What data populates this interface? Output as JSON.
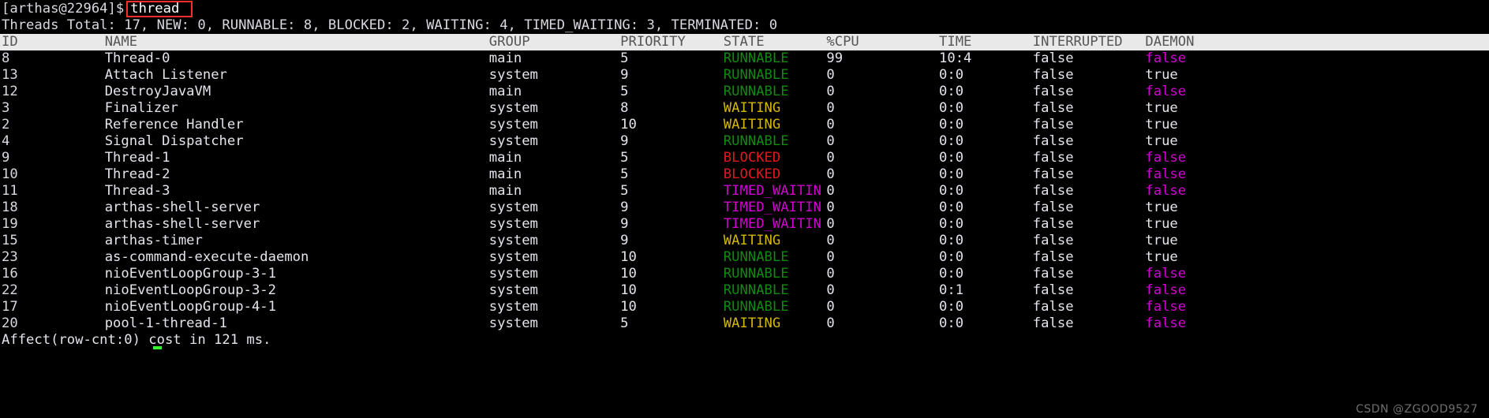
{
  "terminal": {
    "prompt": "[arthas@22964]$",
    "command": "thread",
    "summary": "Threads Total: 17, NEW: 0, RUNNABLE: 8, BLOCKED: 2, WAITING: 4, TIMED_WAITING: 3, TERMINATED: 0",
    "footer": "Affect(row-cnt:0) cost in 121 ms.",
    "watermark": "CSDN @ZGOOD9527"
  },
  "colors": {
    "background": "#000000",
    "foreground": "#e4e4ec",
    "header_background": "#e9e9e9",
    "header_foreground": "#555555",
    "runnable": "#128a12",
    "waiting": "#d4b800",
    "blocked": "#e01b1b",
    "timed_waiting": "#d000d0",
    "daemon_false": "#d000d0",
    "highlight_box": "#ff2d2d",
    "cursor": "#33ff33"
  },
  "table": {
    "columns": [
      {
        "key": "id",
        "label": "ID"
      },
      {
        "key": "name",
        "label": "NAME"
      },
      {
        "key": "group",
        "label": "GROUP"
      },
      {
        "key": "priority",
        "label": "PRIORITY"
      },
      {
        "key": "state",
        "label": "STATE"
      },
      {
        "key": "cpu",
        "label": "%CPU"
      },
      {
        "key": "time",
        "label": "TIME"
      },
      {
        "key": "interrupted",
        "label": "INTERRUPTED"
      },
      {
        "key": "daemon",
        "label": "DAEMON"
      }
    ],
    "rows": [
      {
        "id": "8",
        "name": "Thread-0",
        "group": "main",
        "priority": "5",
        "state": "RUNNABLE",
        "cpu": "99",
        "time": "10:4",
        "interrupted": "false",
        "daemon": "false"
      },
      {
        "id": "13",
        "name": "Attach Listener",
        "group": "system",
        "priority": "9",
        "state": "RUNNABLE",
        "cpu": "0",
        "time": "0:0",
        "interrupted": "false",
        "daemon": "true"
      },
      {
        "id": "12",
        "name": "DestroyJavaVM",
        "group": "main",
        "priority": "5",
        "state": "RUNNABLE",
        "cpu": "0",
        "time": "0:0",
        "interrupted": "false",
        "daemon": "false"
      },
      {
        "id": "3",
        "name": "Finalizer",
        "group": "system",
        "priority": "8",
        "state": "WAITING",
        "cpu": "0",
        "time": "0:0",
        "interrupted": "false",
        "daemon": "true"
      },
      {
        "id": "2",
        "name": "Reference Handler",
        "group": "system",
        "priority": "10",
        "state": "WAITING",
        "cpu": "0",
        "time": "0:0",
        "interrupted": "false",
        "daemon": "true"
      },
      {
        "id": "4",
        "name": "Signal Dispatcher",
        "group": "system",
        "priority": "9",
        "state": "RUNNABLE",
        "cpu": "0",
        "time": "0:0",
        "interrupted": "false",
        "daemon": "true"
      },
      {
        "id": "9",
        "name": "Thread-1",
        "group": "main",
        "priority": "5",
        "state": "BLOCKED",
        "cpu": "0",
        "time": "0:0",
        "interrupted": "false",
        "daemon": "false"
      },
      {
        "id": "10",
        "name": "Thread-2",
        "group": "main",
        "priority": "5",
        "state": "BLOCKED",
        "cpu": "0",
        "time": "0:0",
        "interrupted": "false",
        "daemon": "false"
      },
      {
        "id": "11",
        "name": "Thread-3",
        "group": "main",
        "priority": "5",
        "state": "TIMED_WAITIN",
        "cpu": "0",
        "time": "0:0",
        "interrupted": "false",
        "daemon": "false"
      },
      {
        "id": "18",
        "name": "arthas-shell-server",
        "group": "system",
        "priority": "9",
        "state": "TIMED_WAITIN",
        "cpu": "0",
        "time": "0:0",
        "interrupted": "false",
        "daemon": "true"
      },
      {
        "id": "19",
        "name": "arthas-shell-server",
        "group": "system",
        "priority": "9",
        "state": "TIMED_WAITIN",
        "cpu": "0",
        "time": "0:0",
        "interrupted": "false",
        "daemon": "true"
      },
      {
        "id": "15",
        "name": "arthas-timer",
        "group": "system",
        "priority": "9",
        "state": "WAITING",
        "cpu": "0",
        "time": "0:0",
        "interrupted": "false",
        "daemon": "true"
      },
      {
        "id": "23",
        "name": "as-command-execute-daemon",
        "group": "system",
        "priority": "10",
        "state": "RUNNABLE",
        "cpu": "0",
        "time": "0:0",
        "interrupted": "false",
        "daemon": "true"
      },
      {
        "id": "16",
        "name": "nioEventLoopGroup-3-1",
        "group": "system",
        "priority": "10",
        "state": "RUNNABLE",
        "cpu": "0",
        "time": "0:0",
        "interrupted": "false",
        "daemon": "false"
      },
      {
        "id": "22",
        "name": "nioEventLoopGroup-3-2",
        "group": "system",
        "priority": "10",
        "state": "RUNNABLE",
        "cpu": "0",
        "time": "0:1",
        "interrupted": "false",
        "daemon": "false"
      },
      {
        "id": "17",
        "name": "nioEventLoopGroup-4-1",
        "group": "system",
        "priority": "10",
        "state": "RUNNABLE",
        "cpu": "0",
        "time": "0:0",
        "interrupted": "false",
        "daemon": "false"
      },
      {
        "id": "20",
        "name": "pool-1-thread-1",
        "group": "system",
        "priority": "5",
        "state": "WAITING",
        "cpu": "0",
        "time": "0:0",
        "interrupted": "false",
        "daemon": "false"
      }
    ]
  }
}
